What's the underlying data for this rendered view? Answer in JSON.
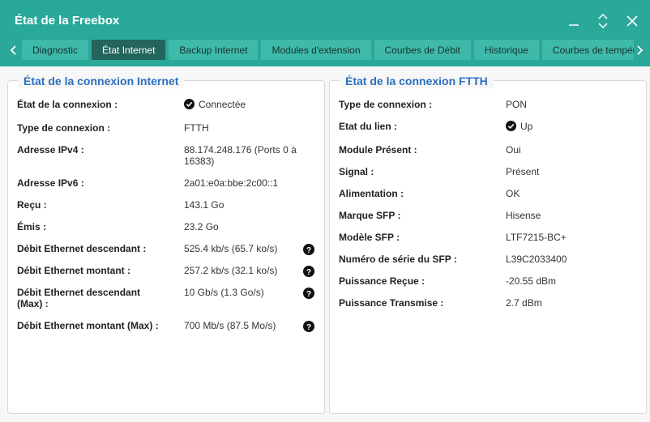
{
  "window": {
    "title": "État de la Freebox"
  },
  "tabs": [
    {
      "label": "Diagnostic"
    },
    {
      "label": "État Internet"
    },
    {
      "label": "Backup Internet"
    },
    {
      "label": "Modules d'extension"
    },
    {
      "label": "Courbes de Débit"
    },
    {
      "label": "Historique"
    },
    {
      "label": "Courbes de tempér"
    }
  ],
  "internet": {
    "title": "État de la connexion Internet",
    "rows": [
      {
        "label": "État de la connexion :",
        "value": "Connectée"
      },
      {
        "label": "Type de connexion :",
        "value": "FTTH"
      },
      {
        "label": "Adresse IPv4 :",
        "value": "88.174.248.176 (Ports 0 à 16383)"
      },
      {
        "label": "Adresse IPv6 :",
        "value": "2a01:e0a:bbe:2c00::1"
      },
      {
        "label": "Reçu :",
        "value": "143.1 Go"
      },
      {
        "label": "Émis :",
        "value": "23.2 Go"
      },
      {
        "label": "Débit Ethernet descendant :",
        "value": "525.4 kb/s (65.7 ko/s)"
      },
      {
        "label": "Débit Ethernet montant :",
        "value": "257.2 kb/s (32.1 ko/s)"
      },
      {
        "label": "Débit Ethernet descendant (Max) :",
        "value": "10 Gb/s (1.3 Go/s)"
      },
      {
        "label": "Débit Ethernet montant (Max) :",
        "value": "700 Mb/s (87.5 Mo/s)"
      }
    ]
  },
  "ftth": {
    "title": "État de la connexion FTTH",
    "rows": [
      {
        "label": "Type de connexion :",
        "value": "PON"
      },
      {
        "label": "Etat du lien :",
        "value": "Up"
      },
      {
        "label": "Module Présent :",
        "value": "Oui"
      },
      {
        "label": "Signal :",
        "value": "Présent"
      },
      {
        "label": "Alimentation :",
        "value": "OK"
      },
      {
        "label": "Marque SFP :",
        "value": "Hisense"
      },
      {
        "label": "Modèle SFP :",
        "value": "LTF7215-BC+"
      },
      {
        "label": "Numéro de série du SFP :",
        "value": "L39C2033400"
      },
      {
        "label": "Puissance Reçue :",
        "value": "-20.55 dBm"
      },
      {
        "label": "Puissance Transmise :",
        "value": "2.7 dBm"
      }
    ]
  }
}
